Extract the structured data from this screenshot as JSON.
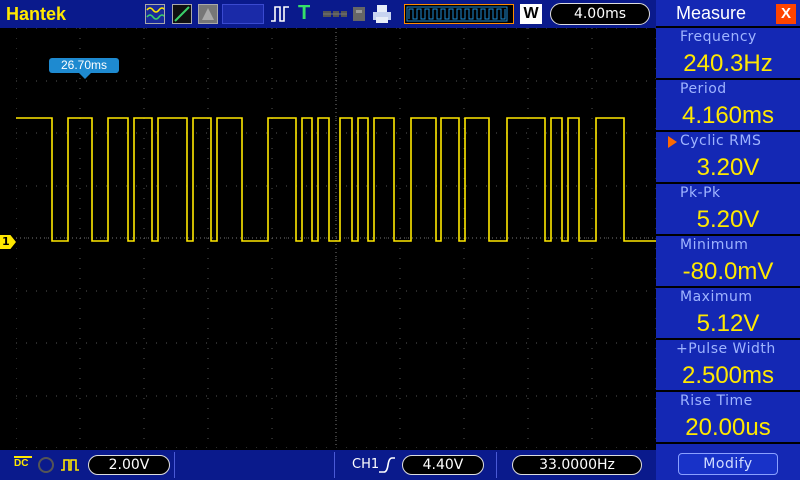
{
  "app": {
    "brand": "Hantek"
  },
  "header": {
    "timebase": "4.00ms",
    "wave_window_letter": "W"
  },
  "screen": {
    "time_offset": "26.70ms",
    "channel_marker": "1",
    "trace_color": "#ffe800"
  },
  "bottom": {
    "volts_per_div": "2.00V",
    "trigger_channel": "CH1",
    "trigger_level": "4.40V",
    "frequency": "33.0000Hz"
  },
  "measure": {
    "title": "Measure",
    "close_label": "X",
    "items": [
      {
        "label": "Frequency",
        "value": "240.3Hz"
      },
      {
        "label": "Period",
        "value": "4.160ms"
      },
      {
        "label": "Cyclic RMS",
        "value": "3.20V",
        "selected": true
      },
      {
        "label": "Pk-Pk",
        "value": "5.20V"
      },
      {
        "label": "Minimum",
        "value": "-80.0mV"
      },
      {
        "label": "Maximum",
        "value": "5.12V"
      },
      {
        "label": "+Pulse Width",
        "value": "2.500ms"
      },
      {
        "label": "Rise Time",
        "value": "20.00us"
      }
    ],
    "modify_label": "Modify"
  },
  "colors": {
    "accent": "#ffe800",
    "panel_bg": "#1428b4",
    "bar_bg": "#0a1a8c",
    "highlight": "#ff6a00"
  }
}
